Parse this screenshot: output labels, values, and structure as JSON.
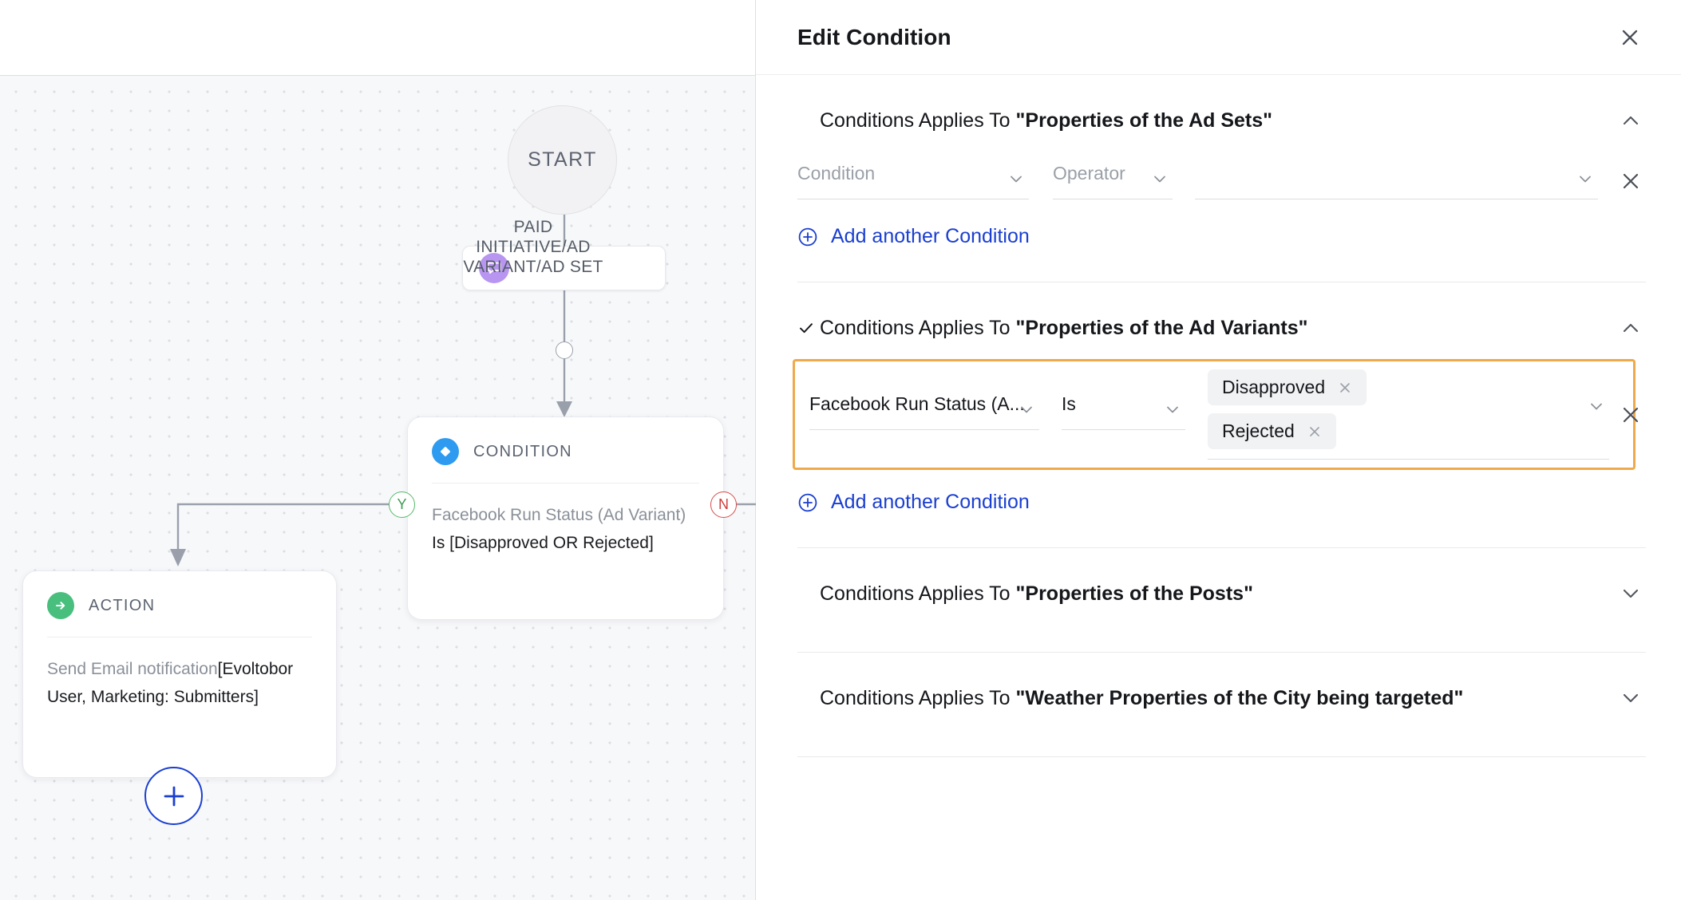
{
  "canvas": {
    "start_node": {
      "label": "START"
    },
    "edge_label": "PAID INITIATIVE/AD VARIANT/AD SET",
    "tag_node": {
      "icon": "speech-bubble-icon",
      "color": "#b795f0"
    },
    "condition_card": {
      "icon": "diamond-icon",
      "icon_color": "#2e9bf0",
      "title": "CONDITION",
      "body_prefix": "Facebook Run Status (Ad Variant) ",
      "body_emphasis": "Is [Disapproved OR Rejected]"
    },
    "action_card": {
      "icon": "arrow-right-circle-icon",
      "icon_color": "#49bf7e",
      "title": "ACTION",
      "body_prefix": "Send Email notification",
      "body_emphasis": "[Evoltobor User, Marketing: Submitters]"
    },
    "port_yes": "Y",
    "port_no": "N",
    "add_node_button": "+"
  },
  "panel": {
    "title": "Edit Condition",
    "close_icon": "close-icon",
    "sections": [
      {
        "prefix": "Conditions Applies To ",
        "target": "\"Properties of the Ad Sets\"",
        "expanded": true,
        "checked": false,
        "chevron": "chevron-up-icon",
        "rows": [
          {
            "condition_placeholder": "Condition",
            "condition_value": "",
            "operator_placeholder": "Operator",
            "operator_value": "",
            "value_placeholder": "",
            "chips": []
          }
        ],
        "add_label": "Add another Condition"
      },
      {
        "prefix": "Conditions Applies To ",
        "target": "\"Properties of the Ad Variants\"",
        "expanded": true,
        "checked": true,
        "chevron": "chevron-up-icon",
        "highlighted": true,
        "rows": [
          {
            "condition_value": "Facebook Run Status (A...",
            "operator_value": "Is",
            "chips": [
              "Disapproved",
              "Rejected"
            ]
          }
        ],
        "add_label": "Add another Condition"
      },
      {
        "prefix": "Conditions Applies To ",
        "target": "\"Properties of the Posts\"",
        "expanded": false,
        "checked": false,
        "chevron": "chevron-down-icon"
      },
      {
        "prefix": "Conditions Applies To ",
        "target": "\"Weather Properties of the City being targeted\"",
        "expanded": false,
        "checked": false,
        "chevron": "chevron-down-icon"
      }
    ]
  },
  "colors": {
    "accent_blue": "#1a3fd0",
    "highlight_orange": "#efa94a",
    "yes_green": "#57b96a",
    "no_red": "#d84a4a",
    "condition_blue": "#2e9bf0",
    "action_green": "#49bf7e",
    "tag_purple": "#b795f0"
  }
}
